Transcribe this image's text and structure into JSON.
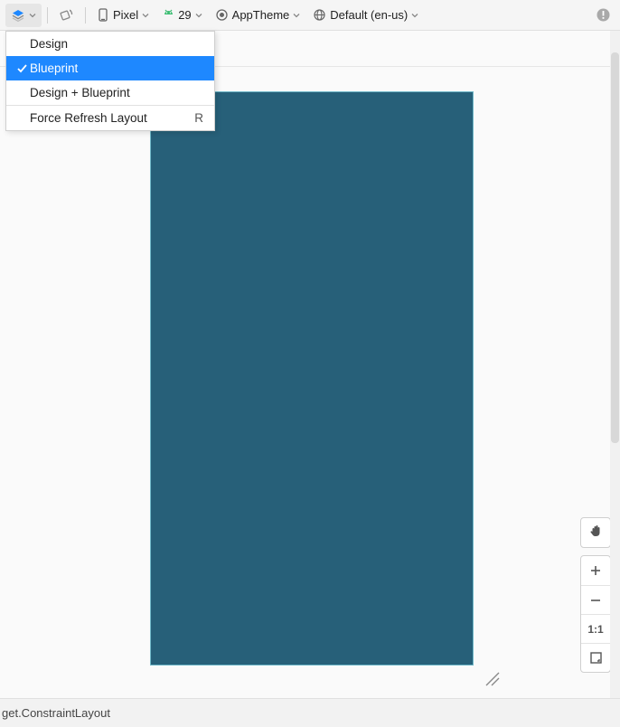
{
  "toolbar": {
    "device": "Pixel",
    "api": "29",
    "theme": "AppTheme",
    "locale": "Default (en-us)"
  },
  "menu": {
    "items": [
      {
        "label": "Design",
        "selected": false,
        "shortcut": ""
      },
      {
        "label": "Blueprint",
        "selected": true,
        "shortcut": ""
      },
      {
        "label": "Design + Blueprint",
        "selected": false,
        "shortcut": ""
      }
    ],
    "refresh_label": "Force Refresh Layout",
    "refresh_shortcut": "R"
  },
  "zoom": {
    "reset_label": "1:1"
  },
  "status": {
    "text": "get.ConstraintLayout"
  },
  "colors": {
    "selection": "#1e88ff",
    "blueprint_bg": "#276079",
    "android_green": "#3dbd73"
  }
}
